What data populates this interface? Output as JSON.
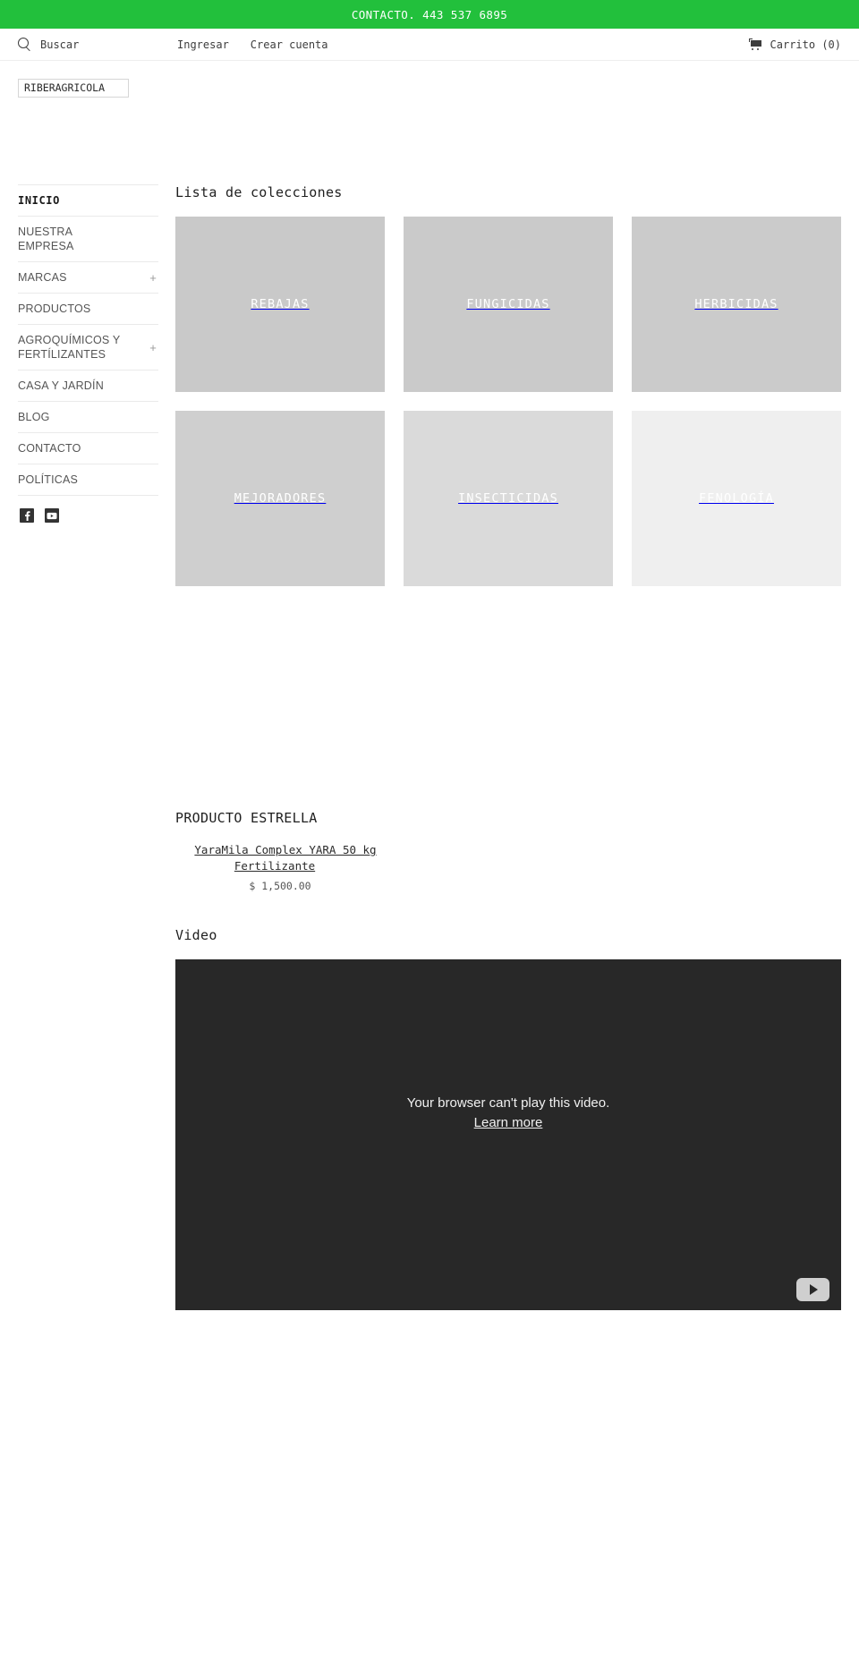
{
  "announcement": {
    "text": "CONTACTO. 443 537 6895",
    "background": "#22c03c",
    "color": "#ffffff"
  },
  "topbar": {
    "search_label": "Buscar",
    "search_icon": "search-icon",
    "login_label": "Ingresar",
    "create_account_label": "Crear cuenta",
    "cart_icon": "cart-icon",
    "cart_label": "Carrito (0)"
  },
  "logo": {
    "alt_text": "RIBERAGRICOLA"
  },
  "sidebar": {
    "items": [
      {
        "label": "INICIO",
        "expandable": false,
        "active": true
      },
      {
        "label": "NUESTRA EMPRESA",
        "expandable": false,
        "active": false
      },
      {
        "label": "MARCAS",
        "expandable": true,
        "expand_glyph": "+",
        "active": false
      },
      {
        "label": "PRODUCTOS",
        "expandable": false,
        "active": false
      },
      {
        "label": "AGROQUÍMICOS Y FERTÍLIZANTES",
        "expandable": true,
        "expand_glyph": "+",
        "active": false
      },
      {
        "label": "CASA Y JARDÍN",
        "expandable": false,
        "active": false
      },
      {
        "label": "BLOG",
        "expandable": false,
        "active": false
      },
      {
        "label": "CONTACTO",
        "expandable": false,
        "active": false
      },
      {
        "label": "POLÍTICAS",
        "expandable": false,
        "active": false
      }
    ],
    "social": [
      {
        "name": "facebook-icon",
        "label": "Facebook"
      },
      {
        "name": "youtube-icon",
        "label": "YouTube"
      }
    ]
  },
  "collections": {
    "title": "Lista de colecciones",
    "tiles": [
      {
        "label": "REBAJAS",
        "background": "#c9c9c9"
      },
      {
        "label": "FUNGICIDAS",
        "background": "#cacaca"
      },
      {
        "label": "HERBICIDAS",
        "background": "#cbcbcb"
      },
      {
        "label": "MEJORADORES",
        "background": "#cfcfcf"
      },
      {
        "label": "INSECTICIDAS",
        "background": "#dadada"
      },
      {
        "label": "FENOLOGÍA",
        "background": "#efefef"
      }
    ]
  },
  "featured": {
    "title": "PRODUCTO ESTRELLA",
    "products": [
      {
        "title": "YaraMila Complex YARA 50 kg Fertilizante",
        "price": "$ 1,500.00",
        "image_background": "#f4f4f4"
      }
    ]
  },
  "video": {
    "title": "Video",
    "error_message": "Your browser can't play this video.",
    "learn_more_label": "Learn more",
    "player_badge": "youtube-play-icon",
    "background": "#282828"
  }
}
